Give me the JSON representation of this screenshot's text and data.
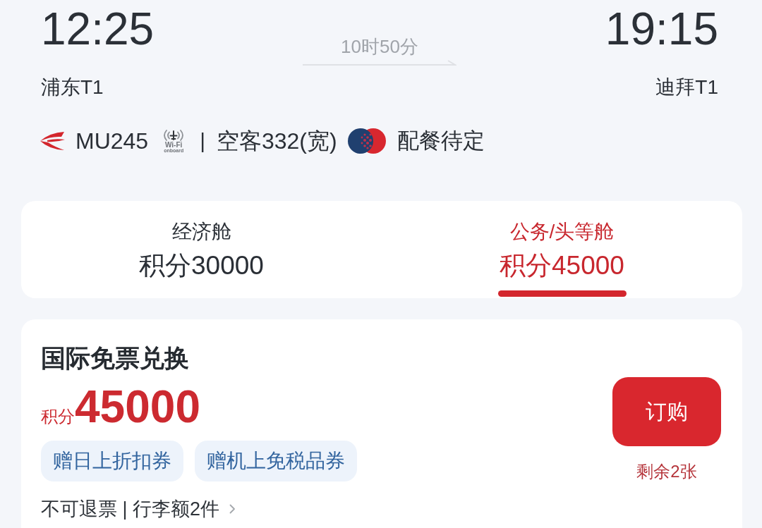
{
  "itinerary": {
    "departure": {
      "time": "12:25",
      "airport": "浦东T1"
    },
    "duration": "10时50分",
    "arrival": {
      "time": "19:15",
      "airport": "迪拜T1"
    }
  },
  "flight_info": {
    "flight_number": "MU245",
    "wifi_badge": {
      "label": "Wi-Fi",
      "caption": "onboard"
    },
    "separator": "|",
    "aircraft": "空客332(宽)",
    "meal": "配餐待定"
  },
  "cabin_tabs": [
    {
      "cabin": "经济舱",
      "price": "积分30000",
      "selected": false
    },
    {
      "cabin": "公务/头等舱",
      "price": "积分45000",
      "selected": true
    }
  ],
  "offer": {
    "title": "国际免票兑换",
    "price_unit": "积分",
    "price": "45000",
    "tags": [
      "赠日上折扣券",
      "赠机上免税品券"
    ],
    "terms": "不可退票 | 行李额2件",
    "order_button": "订购",
    "remaining": "剩余2张"
  }
}
